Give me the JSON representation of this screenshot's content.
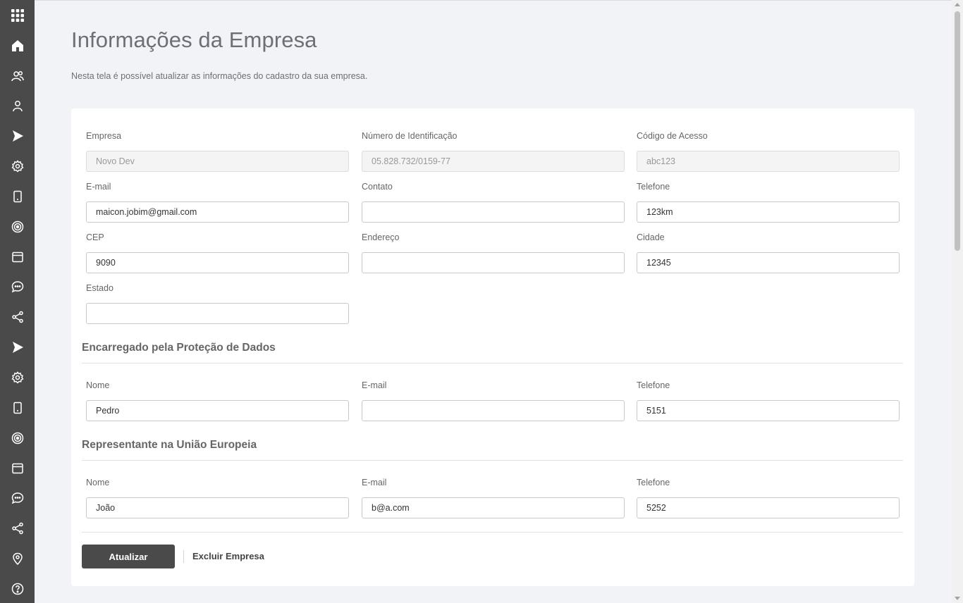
{
  "sidebar": {
    "icons": [
      "apps-grid-icon",
      "home-icon",
      "users-icon",
      "user-icon",
      "play-icon",
      "settings-icon",
      "mobile-icon",
      "target-icon",
      "browser-icon",
      "chat-icon",
      "share-icon",
      "play-icon",
      "settings-icon",
      "mobile-icon",
      "target-icon",
      "browser-icon",
      "chat-icon",
      "share-icon",
      "location-icon",
      "help-icon"
    ]
  },
  "page": {
    "title": "Informações da Empresa",
    "subtitle": "Nesta tela é possível atualizar as informações do cadastro da sua empresa."
  },
  "company": {
    "empresa": {
      "label": "Empresa",
      "value": "Novo Dev"
    },
    "numero": {
      "label": "Número de Identificação",
      "value": "05.828.732/0159-77"
    },
    "codigo": {
      "label": "Código de Acesso",
      "value": "abc123"
    },
    "email": {
      "label": "E-mail",
      "value": "maicon.jobim@gmail.com"
    },
    "contato": {
      "label": "Contato",
      "value": ""
    },
    "telefone": {
      "label": "Telefone",
      "value": "123km"
    },
    "cep": {
      "label": "CEP",
      "value": "9090"
    },
    "endereco": {
      "label": "Endereço",
      "value": ""
    },
    "cidade": {
      "label": "Cidade",
      "value": "12345"
    },
    "estado": {
      "label": "Estado",
      "value": ""
    }
  },
  "dpo": {
    "title": "Encarregado pela Proteção de Dados",
    "nome": {
      "label": "Nome",
      "value": "Pedro"
    },
    "email": {
      "label": "E-mail",
      "value": ""
    },
    "telefone": {
      "label": "Telefone",
      "value": "5151"
    }
  },
  "eu_rep": {
    "title": "Representante na União Europeia",
    "nome": {
      "label": "Nome",
      "value": "João"
    },
    "email": {
      "label": "E-mail",
      "value": "b@a.com"
    },
    "telefone": {
      "label": "Telefone",
      "value": "5252"
    }
  },
  "actions": {
    "update_label": "Atualizar",
    "delete_label": "Excluir Empresa"
  }
}
